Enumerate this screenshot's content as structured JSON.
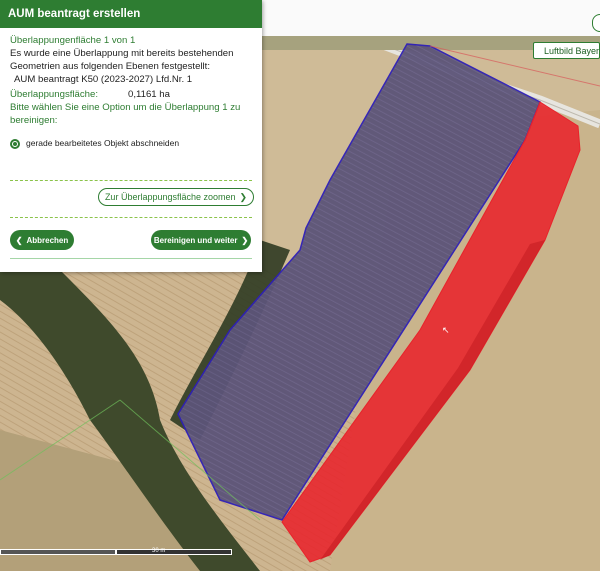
{
  "panel": {
    "title": "AUM beantragt erstellen",
    "overlap_heading": "Überlappungenfläche 1 von 1",
    "description_line1": "Es wurde eine Überlappung mit bereits bestehenden",
    "description_line2": "Geometrien aus folgenden Ebenen festgestellt:",
    "layer_entry": "AUM beantragt K50 (2023-2027) Lfd.Nr. 1",
    "area_label": "Überlappungsfläche:",
    "area_value": "0,1161 ha",
    "instruction": "Bitte wählen Sie eine Option um die Überlappung 1 zu bereinigen:",
    "option_label": "gerade bearbeitetes Objekt abschneiden",
    "zoom_button": "Zur Überlappungsfläche zoomen",
    "cancel_button": "Abbrechen",
    "confirm_button": "Bereinigen und weiter"
  },
  "map": {
    "layer_button": "Luftbild Bayern",
    "scale_label": "30 m",
    "colors": {
      "accent": "#2e7d32",
      "overlap": "#e8232b",
      "parcel": "#5b4fa8"
    }
  }
}
